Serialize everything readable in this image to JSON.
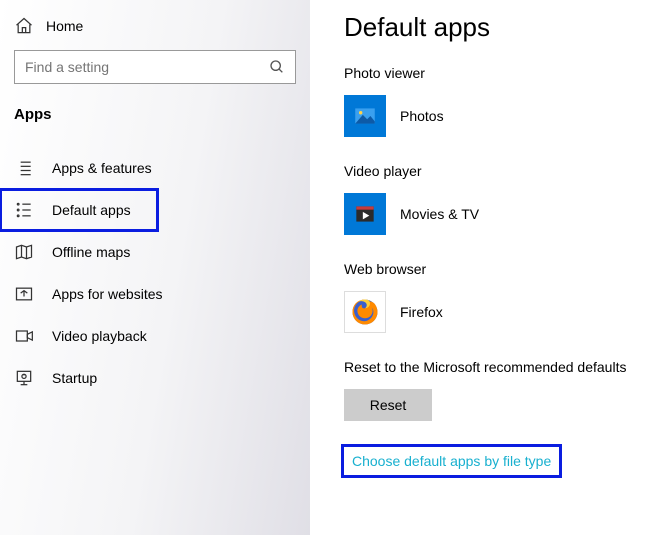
{
  "sidebar": {
    "home": "Home",
    "search_placeholder": "Find a setting",
    "section_title": "Apps",
    "items": [
      {
        "label": "Apps & features"
      },
      {
        "label": "Default apps"
      },
      {
        "label": "Offline maps"
      },
      {
        "label": "Apps for websites"
      },
      {
        "label": "Video playback"
      },
      {
        "label": "Startup"
      }
    ]
  },
  "main": {
    "title": "Default apps",
    "categories": [
      {
        "label": "Photo viewer",
        "app": "Photos"
      },
      {
        "label": "Video player",
        "app": "Movies & TV"
      },
      {
        "label": "Web browser",
        "app": "Firefox"
      }
    ],
    "reset_label": "Reset to the Microsoft recommended defaults",
    "reset_button": "Reset",
    "link": "Choose default apps by file type"
  }
}
